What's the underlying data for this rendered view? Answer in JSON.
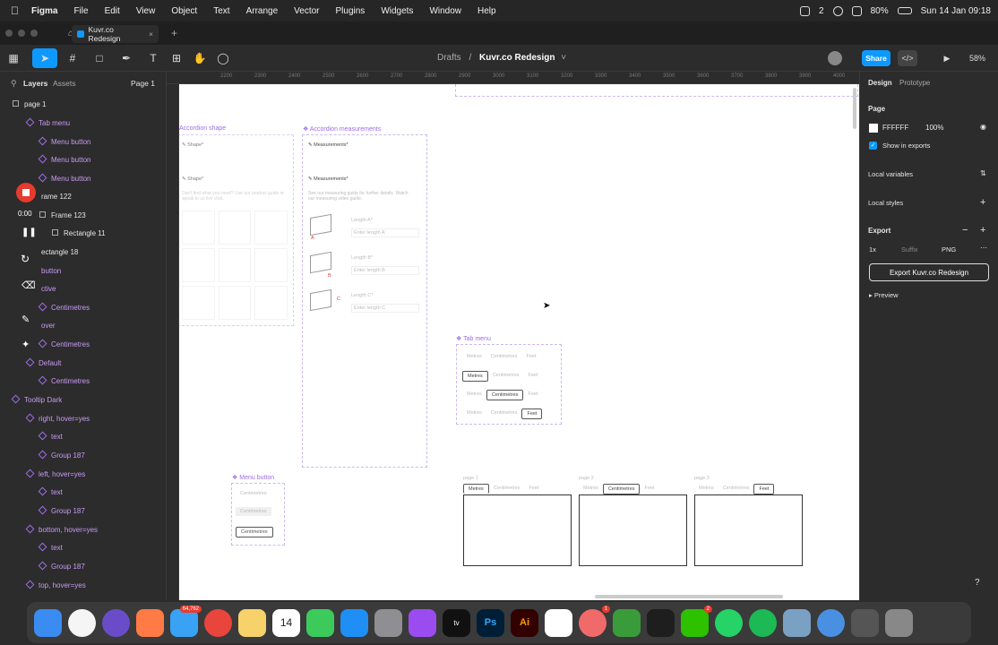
{
  "menubar": {
    "app": "Figma",
    "items": [
      "File",
      "Edit",
      "View",
      "Object",
      "Text",
      "Arrange",
      "Vector",
      "Plugins",
      "Widgets",
      "Window",
      "Help"
    ],
    "battery": "80%",
    "datetime": "Sun 14 Jan  09:18",
    "notif_count": "2"
  },
  "tab": {
    "title": "Kuvr.co Redesign"
  },
  "breadcrumb": {
    "drafts": "Drafts",
    "file": "Kuvr.co Redesign"
  },
  "toolbar": {
    "share": "Share",
    "zoom": "58%"
  },
  "left": {
    "tabs": [
      "Layers",
      "Assets"
    ],
    "page_selector": "Page 1",
    "layers": [
      "page 1",
      "Tab menu",
      "Menu button",
      "Menu button",
      "Menu button",
      "rame 122",
      "Frame 123",
      "Rectangle 11",
      "ectangle 18",
      "button",
      "ctive",
      "Centimetres",
      "over",
      "Centimetres",
      "Default",
      "Centimetres",
      "Tooltip Dark",
      "right, hover=yes",
      "text",
      "Group 187",
      "left, hover=yes",
      "text",
      "Group 187",
      "bottom, hover=yes",
      "text",
      "Group 187",
      "top, hover=yes"
    ]
  },
  "recording": {
    "time": "0:00"
  },
  "ruler": [
    "2200",
    "2300",
    "2400",
    "2500",
    "2600",
    "2700",
    "2800",
    "2900",
    "3000",
    "3100",
    "3200",
    "3300",
    "3400",
    "3500",
    "3600",
    "3700",
    "3800",
    "3900",
    "4000"
  ],
  "canvas": {
    "accordion_shape": {
      "label": "Accordion shape",
      "row1": "Shape*",
      "row2": "Shape*",
      "hint": "Don't find what you need? Use our product guide or speak to us live chat."
    },
    "accordion_measure": {
      "label": "Accordion measurements",
      "row1": "Measurements*",
      "row2": "Measurements*",
      "hint": "See our measuring guide for further details. Watch our measuring video guide.",
      "fields": [
        {
          "label": "Length A*",
          "placeholder": "Enter length A",
          "tag": "A"
        },
        {
          "label": "Length B*",
          "placeholder": "Enter length B",
          "tag": "B"
        },
        {
          "label": "Length C*",
          "placeholder": "Enter length C",
          "tag": "C"
        }
      ]
    },
    "tab_menu": {
      "label": "Tab menu",
      "options": [
        "Metres",
        "Centimetres",
        "Feet"
      ]
    },
    "menu_button": {
      "label": "Menu button",
      "items": [
        "Centimetres",
        "Centimetres",
        "Centimetres"
      ]
    },
    "pages": [
      "page 1",
      "page 2",
      "page 3"
    ]
  },
  "right": {
    "tabs": [
      "Design",
      "Prototype"
    ],
    "page_heading": "Page",
    "bg_color": "FFFFFF",
    "bg_opacity": "100%",
    "show_exports": "Show in exports",
    "local_variables": "Local variables",
    "local_styles": "Local styles",
    "export": "Export",
    "scale": "1x",
    "suffix": "Suffix",
    "format": "PNG",
    "export_btn": "Export Kuvr.co Redesign",
    "preview": "Preview"
  },
  "dock": {
    "badges": {
      "mail": "64,762",
      "calendar_day": "14",
      "slack": "1",
      "whatsapp": "2"
    }
  }
}
